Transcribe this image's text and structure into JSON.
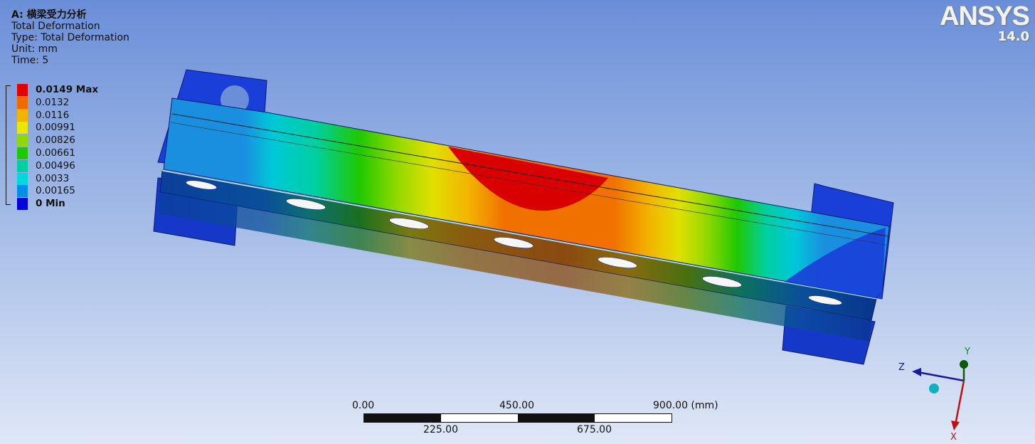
{
  "result": {
    "title": "A: 横梁受力分析",
    "name": "Total Deformation",
    "type": "Type: Total Deformation",
    "unit": "Unit: mm",
    "time": "Time: 5"
  },
  "legend": {
    "items": [
      {
        "label": "0.0149 Max",
        "color": "#e00000",
        "bold": true
      },
      {
        "label": "0.0132",
        "color": "#f06a00"
      },
      {
        "label": "0.0116",
        "color": "#f2b400"
      },
      {
        "label": "0.00991",
        "color": "#e8e800"
      },
      {
        "label": "0.00826",
        "color": "#8fd800"
      },
      {
        "label": "0.00661",
        "color": "#1fc800"
      },
      {
        "label": "0.00496",
        "color": "#00d0a0"
      },
      {
        "label": "0.0033",
        "color": "#00d8e0"
      },
      {
        "label": "0.00165",
        "color": "#0090e8"
      },
      {
        "label": "0 Min",
        "color": "#0000d8",
        "bold": true
      }
    ]
  },
  "logo": {
    "name": "ANSYS",
    "version": "14.0"
  },
  "scale_bar": {
    "top_labels": [
      "0.00",
      "450.00",
      "900.00 (mm)"
    ],
    "bottom_labels": [
      "225.00",
      "675.00"
    ]
  },
  "triad": {
    "axes": [
      "Y",
      "Z",
      "X"
    ]
  }
}
